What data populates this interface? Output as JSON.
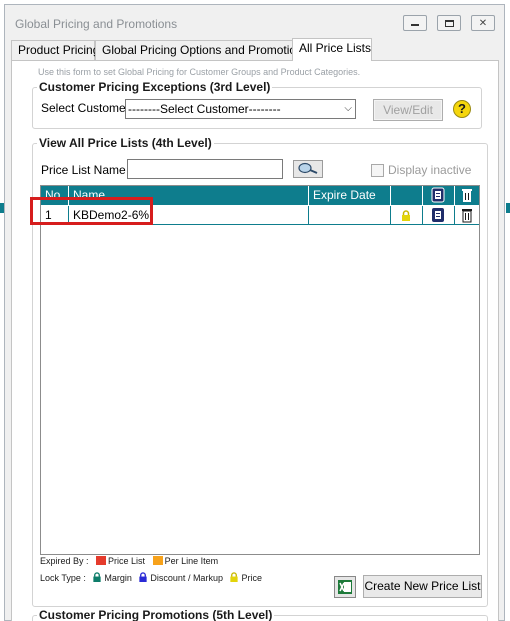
{
  "window": {
    "title": "Global Pricing and Promotions"
  },
  "tabs": [
    {
      "label": "Product Pricing",
      "active": false
    },
    {
      "label": "Global Pricing Options and Promotions",
      "active": false
    },
    {
      "label": "All Price Lists",
      "active": true
    }
  ],
  "hint": "Use this form to set Global Pricing for Customer Groups and Product Categories.",
  "customer_exceptions": {
    "title": "Customer Pricing Exceptions (3rd Level)",
    "select_label": "Select Customer",
    "select_value": "--------Select Customer--------",
    "view_edit_label": "View/Edit",
    "help_glyph": "?"
  },
  "price_lists": {
    "title": "View All Price Lists (4th Level)",
    "name_label": "Price List Name",
    "name_value": "",
    "display_inactive_label": "Display inactive",
    "display_inactive_checked": false,
    "columns": [
      "No",
      "Name",
      "Expire Date"
    ],
    "rows": [
      {
        "no": "1",
        "name": "KBDemo2-6%",
        "expire_date": "",
        "lock": "lock-yellow-icon"
      }
    ]
  },
  "legend": {
    "expired_by_label": "Expired By :",
    "expired_items": [
      {
        "label": "Price List",
        "color": "#e53b2c"
      },
      {
        "label": "Per Line Item",
        "color": "#f7a21b"
      }
    ],
    "lock_type_label": "Lock Type :",
    "lock_items": [
      {
        "label": "Margin",
        "color": "#0e7d6a"
      },
      {
        "label": "Discount / Markup",
        "color": "#2a2ad6"
      },
      {
        "label": "Price",
        "color": "#d8c808"
      }
    ]
  },
  "create_button_label": "Create New Price List",
  "promotions_title": "Customer Pricing Promotions (5th Level)",
  "colors": {
    "grid_header": "#0e7d8d",
    "highlight": "#d61d1d"
  }
}
